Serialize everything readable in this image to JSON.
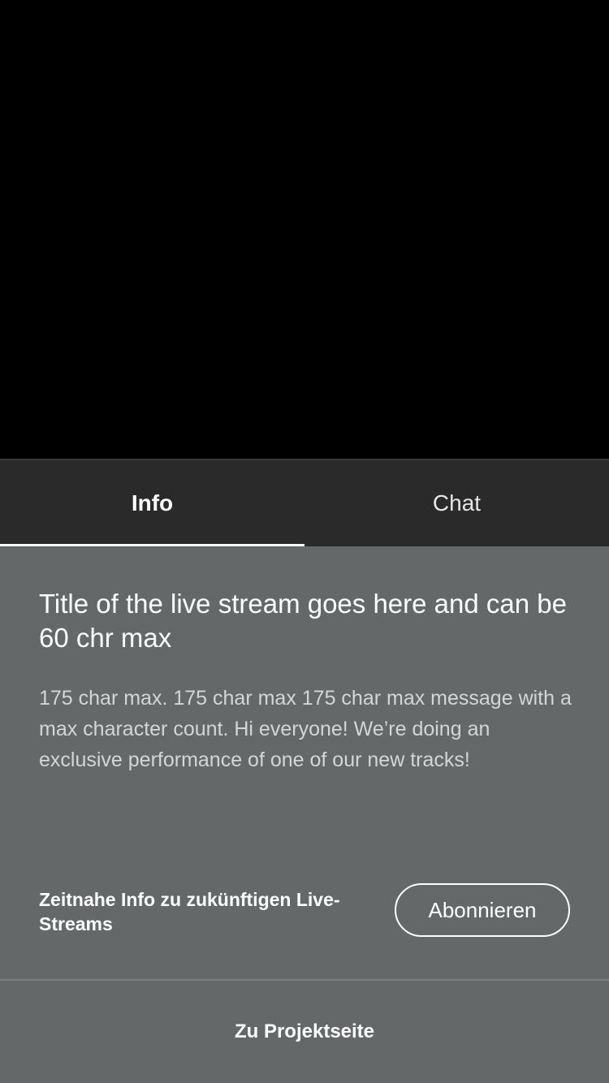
{
  "tabs": [
    {
      "label": "Info",
      "active": true
    },
    {
      "label": "Chat",
      "active": false
    }
  ],
  "stream": {
    "title": "Title of the live stream goes here and can be 60 chr max",
    "description": "175 char max. 175 char max 175 char max message with a max character count. Hi everyone! We’re doing an exclusive performance of one of our new tracks!"
  },
  "subscribe": {
    "text": "Zeitnahe Info zu zukünftigen Live-Streams",
    "button_label": "Abonnieren"
  },
  "project_link": {
    "label": "Zu Projektseite"
  },
  "colors": {
    "video_bg": "#000000",
    "tabbar_bg": "#2a2a2a",
    "panel_bg": "#646868",
    "text_primary": "#ffffff",
    "text_secondary": "#d3d6d6"
  }
}
